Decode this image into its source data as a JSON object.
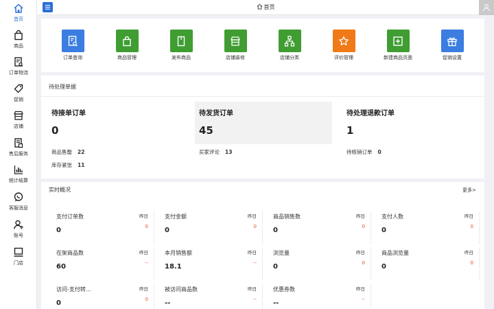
{
  "sidebar": {
    "items": [
      {
        "label": "首页",
        "icon": "home-icon"
      },
      {
        "label": "商品",
        "icon": "bag-icon"
      },
      {
        "label": "订单物流",
        "icon": "order-icon"
      },
      {
        "label": "促销",
        "icon": "tag-icon"
      },
      {
        "label": "店铺",
        "icon": "store-icon"
      },
      {
        "label": "售后服务",
        "icon": "aftersale-icon"
      },
      {
        "label": "统计结算",
        "icon": "chart-icon"
      },
      {
        "label": "客服消息",
        "icon": "message-icon"
      },
      {
        "label": "账号",
        "icon": "account-icon"
      },
      {
        "label": "门店",
        "icon": "shop-icon"
      }
    ]
  },
  "header": {
    "title": "首页",
    "menu_icon": "menu-icon",
    "avatar_icon": "user-icon"
  },
  "quick_actions": [
    {
      "label": "订单查询",
      "color": "#3b7de0",
      "icon": "order-search-icon"
    },
    {
      "label": "商品管理",
      "color": "#3f9d32",
      "icon": "bag-icon"
    },
    {
      "label": "发布商品",
      "color": "#3f9d32",
      "icon": "publish-icon"
    },
    {
      "label": "店铺装修",
      "color": "#3f9d32",
      "icon": "store-icon"
    },
    {
      "label": "店铺分类",
      "color": "#3f9d32",
      "icon": "category-icon"
    },
    {
      "label": "评价管理",
      "color": "#f07a17",
      "icon": "star-icon"
    },
    {
      "label": "新建商品页面",
      "color": "#3f9d32",
      "icon": "new-page-icon"
    },
    {
      "label": "促销设置",
      "color": "#3b7de0",
      "icon": "gift-icon"
    }
  ],
  "pending": {
    "title": "待处理单据",
    "cards": [
      {
        "title": "待接单订单",
        "value": "0"
      },
      {
        "title": "待发货订单",
        "value": "45"
      },
      {
        "title": "待处理退款订单",
        "value": "1"
      }
    ],
    "stats": [
      {
        "label": "商品售罄",
        "value": "22"
      },
      {
        "label": "库存紧张",
        "value": "11"
      },
      {
        "label": "买家评论",
        "value": "13"
      },
      {
        "label": "待核销订单",
        "value": "0"
      }
    ]
  },
  "realtime": {
    "title": "实时概况",
    "more": "更多>",
    "yesterday_label": "昨日",
    "stats": [
      {
        "label": "支付订单数",
        "value": "0",
        "compare": "0"
      },
      {
        "label": "支付金额",
        "value": "0",
        "compare": "0"
      },
      {
        "label": "商品销售数",
        "value": "0",
        "compare": "0"
      },
      {
        "label": "支付人数",
        "value": "0",
        "compare": "0"
      },
      {
        "label": "在架商品数",
        "value": "60",
        "compare": "--"
      },
      {
        "label": "本月销售额",
        "value": "18.1",
        "compare": "--"
      },
      {
        "label": "浏览量",
        "value": "0",
        "compare": "0"
      },
      {
        "label": "商品浏览量",
        "value": "0",
        "compare": "0"
      },
      {
        "label": "访问-支付转...",
        "value": "0",
        "compare": "0"
      },
      {
        "label": "被访问商品数",
        "value": "--",
        "compare": "--"
      },
      {
        "label": "优惠券数",
        "value": "--",
        "compare": "--"
      }
    ]
  }
}
